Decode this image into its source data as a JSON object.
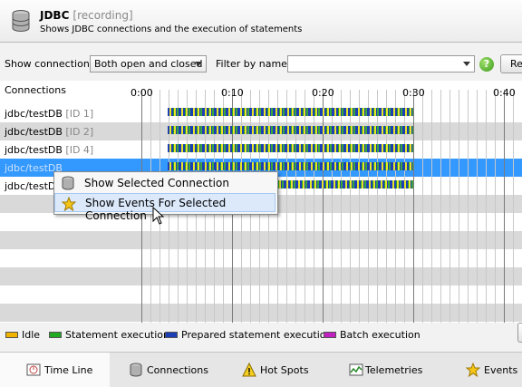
{
  "header": {
    "title": "JDBC",
    "status": "[recording]",
    "subtitle": "Shows JDBC connections and the execution of statements"
  },
  "toolbar": {
    "show_label": "Show connections:",
    "show_value": "Both open and closed",
    "filter_label": "Filter by name:",
    "filter_value": "",
    "help_glyph": "?",
    "reset_label": "Re"
  },
  "timeline": {
    "column_header": "Connections",
    "ticks": [
      "0:00",
      "0:10",
      "0:20",
      "0:30",
      "0:40"
    ],
    "rows": [
      {
        "name": "jdbc/testDB",
        "id": "[ID 1]"
      },
      {
        "name": "jdbc/testDB",
        "id": "[ID 2]"
      },
      {
        "name": "jdbc/testDB",
        "id": "[ID 4]"
      },
      {
        "name": "jdbc/testDB",
        "id": ""
      },
      {
        "name": "jdbc/testDB",
        "id": ""
      }
    ],
    "selected_row": 3
  },
  "context_menu": {
    "items": [
      {
        "label": "Show Selected Connection",
        "icon": "database-icon"
      },
      {
        "label": "Show Events For Selected Connection",
        "icon": "star-icon"
      }
    ]
  },
  "legend": {
    "items": [
      {
        "label": "Idle",
        "color": "#f0b400"
      },
      {
        "label": "Statement execution",
        "color": "#22aa22"
      },
      {
        "label": "Prepared statement execution",
        "color": "#1d3fb5"
      },
      {
        "label": "Batch execution",
        "color": "#c020c0"
      }
    ]
  },
  "tabs": [
    {
      "label": "Time Line",
      "icon": "timeline-icon",
      "active": true
    },
    {
      "label": "Connections",
      "icon": "database-icon",
      "active": false
    },
    {
      "label": "Hot Spots",
      "icon": "warning-icon",
      "active": false
    },
    {
      "label": "Telemetries",
      "icon": "telemetry-icon",
      "active": false
    },
    {
      "label": "Events",
      "icon": "star-icon",
      "active": false
    }
  ]
}
